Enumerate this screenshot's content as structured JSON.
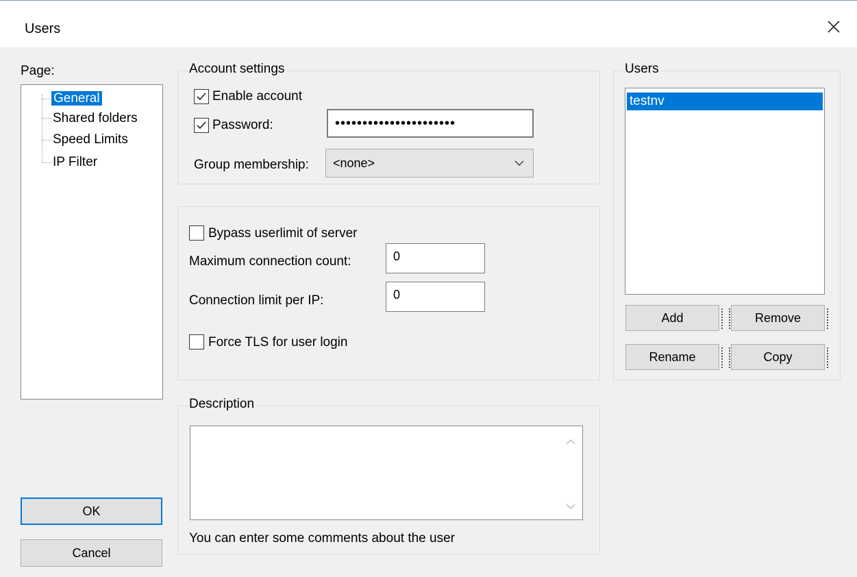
{
  "window": {
    "title": "Users"
  },
  "page_panel": {
    "label": "Page:",
    "items": [
      {
        "label": "General",
        "selected": true
      },
      {
        "label": "Shared folders",
        "selected": false
      },
      {
        "label": "Speed Limits",
        "selected": false
      },
      {
        "label": "IP Filter",
        "selected": false
      }
    ]
  },
  "account_settings": {
    "title": "Account settings",
    "enable_account_label": "Enable account",
    "enable_account_checked": true,
    "password_label": "Password:",
    "password_checked": true,
    "password_value": "••••••••••••••••••••••",
    "group_membership_label": "Group membership:",
    "group_membership_value": "<none>"
  },
  "limits": {
    "bypass_label": "Bypass userlimit of server",
    "bypass_checked": false,
    "max_connection_label": "Maximum connection count:",
    "max_connection_value": "0",
    "per_ip_label": "Connection limit per IP:",
    "per_ip_value": "0",
    "force_tls_label": "Force TLS for user login",
    "force_tls_checked": false
  },
  "description": {
    "title": "Description",
    "value": "",
    "hint": "You can enter some comments about the user"
  },
  "users_panel": {
    "title": "Users",
    "users": [
      {
        "name": "testnv",
        "selected": true
      }
    ],
    "add_label": "Add",
    "remove_label": "Remove",
    "rename_label": "Rename",
    "copy_label": "Copy"
  },
  "footer": {
    "ok_label": "OK",
    "cancel_label": "Cancel"
  },
  "colors": {
    "selection": "#0078d7",
    "dialog_bg": "#f0f0f0"
  }
}
